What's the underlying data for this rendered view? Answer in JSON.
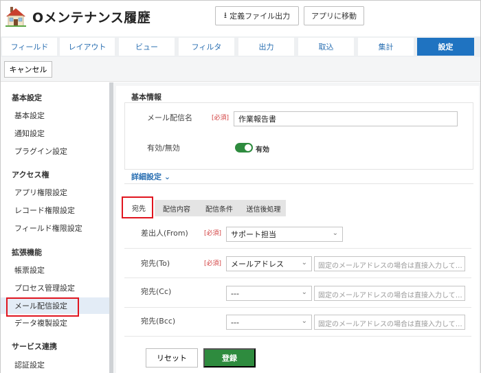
{
  "header": {
    "title": "Oメンテナンス履歴",
    "export_label": "定義ファイル出力",
    "goto_app_label": "アプリに移動"
  },
  "tabs": [
    {
      "label": "フィールド"
    },
    {
      "label": "レイアウト"
    },
    {
      "label": "ビュー"
    },
    {
      "label": "フィルタ"
    },
    {
      "label": "出力"
    },
    {
      "label": "取込"
    },
    {
      "label": "集計"
    },
    {
      "label": "設定",
      "active": true
    }
  ],
  "cancel_label": "キャンセル",
  "sidebar": {
    "sections": [
      {
        "title": "基本設定",
        "items": [
          "基本設定",
          "通知設定",
          "プラグイン設定"
        ]
      },
      {
        "title": "アクセス権",
        "items": [
          "アプリ権限設定",
          "レコード権限設定",
          "フィールド権限設定"
        ]
      },
      {
        "title": "拡張機能",
        "items": [
          "帳票設定",
          "プロセス管理設定",
          "メール配信設定",
          "データ複製設定"
        ]
      },
      {
        "title": "サービス連携",
        "items": [
          "認証設定"
        ]
      }
    ],
    "active_item": "メール配信設定"
  },
  "basic": {
    "title": "基本情報",
    "mail_name_label": "メール配信名",
    "required": "[必須]",
    "mail_name_value": "作業報告書",
    "enabled_label": "有効/無効",
    "enabled_text": "有効"
  },
  "detail_label": "詳細設定",
  "subtabs": [
    {
      "label": "宛先",
      "active": true
    },
    {
      "label": "配信内容"
    },
    {
      "label": "配信条件"
    },
    {
      "label": "送信後処理"
    }
  ],
  "recipients": {
    "from_label": "差出人(From)",
    "from_value": "サポート担当",
    "to_label": "宛先(To)",
    "to_value": "メールアドレス",
    "cc_label": "宛先(Cc)",
    "cc_value": "---",
    "bcc_label": "宛先(Bcc)",
    "bcc_value": "---",
    "address_placeholder": "固定のメールアドレスの場合は直接入力して…"
  },
  "actions": {
    "reset_label": "リセット",
    "save_label": "登録"
  },
  "colors": {
    "accent": "#1f73c1",
    "save_green": "#2e8b3e",
    "required_red": "#d23c3c",
    "highlight_red": "#e0141e"
  }
}
